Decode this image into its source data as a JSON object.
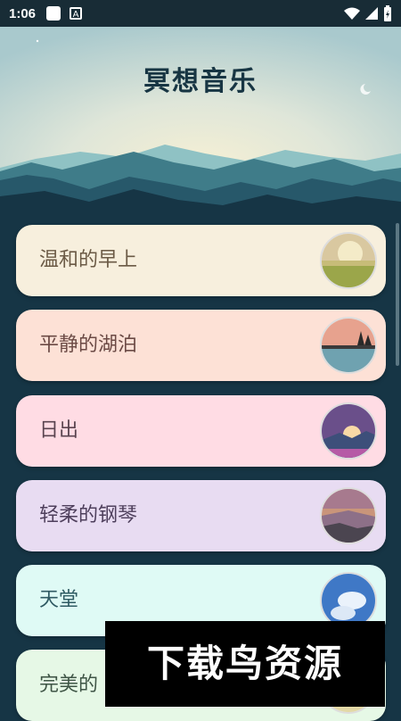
{
  "status_bar": {
    "time": "1:06"
  },
  "header": {
    "title": "冥想音乐"
  },
  "tracks": [
    {
      "label": "温和的早上",
      "bg": "#f7efdd",
      "text_color": "#6b5a45"
    },
    {
      "label": "平静的湖泊",
      "bg": "#fde1d6",
      "text_color": "#6b4a45"
    },
    {
      "label": "日出",
      "bg": "#ffdce4",
      "text_color": "#5a4450"
    },
    {
      "label": "轻柔的钢琴",
      "bg": "#e8dcf2",
      "text_color": "#4e3f5c"
    },
    {
      "label": "天堂",
      "bg": "#dffaf5",
      "text_color": "#2f5a63"
    },
    {
      "label": "完美的",
      "bg": "#e6f8e6",
      "text_color": "#3f5546"
    }
  ],
  "watermark": {
    "text": "下载鸟资源"
  }
}
